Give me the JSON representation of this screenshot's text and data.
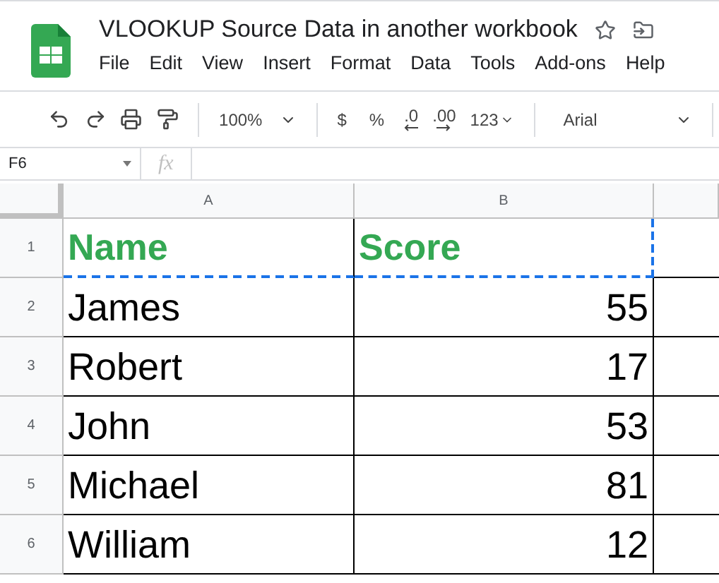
{
  "document": {
    "title": "VLOOKUP Source Data in another workbook"
  },
  "menu": [
    "File",
    "Edit",
    "View",
    "Insert",
    "Format",
    "Data",
    "Tools",
    "Add-ons",
    "Help"
  ],
  "toolbar": {
    "zoom": "100%",
    "currency": "$",
    "percent": "%",
    "decrease_decimals": ".0",
    "increase_decimals": ".00",
    "number_format": "123",
    "font": "Arial"
  },
  "formula_bar": {
    "cell_ref": "F6",
    "fx": "fx"
  },
  "sheet": {
    "columns": [
      "A",
      "B"
    ],
    "rows": [
      {
        "number": "1",
        "cells": [
          "Name",
          "Score"
        ],
        "header": true
      },
      {
        "number": "2",
        "cells": [
          "James",
          "55"
        ],
        "header": false
      },
      {
        "number": "3",
        "cells": [
          "Robert",
          "17"
        ],
        "header": false
      },
      {
        "number": "4",
        "cells": [
          "John",
          "53"
        ],
        "header": false
      },
      {
        "number": "5",
        "cells": [
          "Michael",
          "81"
        ],
        "header": false
      },
      {
        "number": "6",
        "cells": [
          "William",
          "12"
        ],
        "header": false
      }
    ]
  }
}
